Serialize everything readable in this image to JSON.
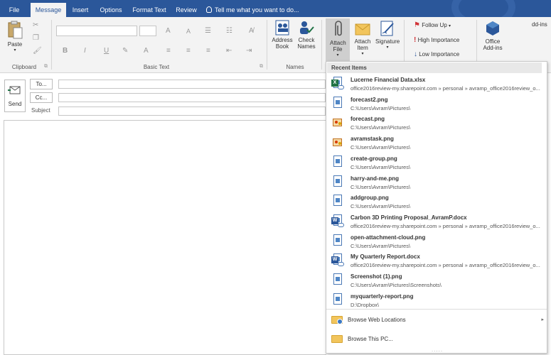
{
  "tabs": [
    {
      "label": "File",
      "active": false
    },
    {
      "label": "Message",
      "active": true
    },
    {
      "label": "Insert",
      "active": false
    },
    {
      "label": "Options",
      "active": false
    },
    {
      "label": "Format Text",
      "active": false
    },
    {
      "label": "Review",
      "active": false
    }
  ],
  "tell_me": "Tell me what you want to do...",
  "ribbon": {
    "clipboard": {
      "paste": "Paste",
      "label": "Clipboard"
    },
    "basic_text": {
      "label": "Basic Text"
    },
    "names": {
      "address_book": "Address Book",
      "check_names": "Check Names",
      "label": "Names"
    },
    "include": {
      "attach_file": "Attach File",
      "attach_item": "Attach Item",
      "signature": "Signature"
    },
    "tags": {
      "follow_up": "Follow Up",
      "high_importance": "High Importance",
      "low_importance": "Low Importance"
    },
    "addins": {
      "office_addins": "Office Add-ins"
    },
    "truncated": "dd-ins"
  },
  "compose": {
    "send": "Send",
    "to": "To...",
    "cc": "Cc...",
    "subject": "Subject"
  },
  "dropdown": {
    "header": "Recent Items",
    "items": [
      {
        "name": "Lucerne Financial Data.xlsx",
        "path": "office2016review-my.sharepoint.com » personal » avramp_office2016review_o...",
        "icon": "excel-cloud-icon"
      },
      {
        "name": "forecast2.png",
        "path": "C:\\Users\\Avram\\Pictures\\",
        "icon": "image-icon"
      },
      {
        "name": "forecast.png",
        "path": "C:\\Users\\Avram\\Pictures\\",
        "icon": "paint-icon"
      },
      {
        "name": "avramstask.png",
        "path": "C:\\Users\\Avram\\Pictures\\",
        "icon": "paint-icon"
      },
      {
        "name": "create-group.png",
        "path": "C:\\Users\\Avram\\Pictures\\",
        "icon": "image-icon"
      },
      {
        "name": "harry-and-me.png",
        "path": "C:\\Users\\Avram\\Pictures\\",
        "icon": "image-icon"
      },
      {
        "name": "addgroup.png",
        "path": "C:\\Users\\Avram\\Pictures\\",
        "icon": "image-icon"
      },
      {
        "name": "Carbon 3D Printing Proposal_AvramP.docx",
        "path": "office2016review-my.sharepoint.com » personal » avramp_office2016review_o...",
        "icon": "word-cloud-icon"
      },
      {
        "name": "open-attachment-cloud.png",
        "path": "C:\\Users\\Avram\\Pictures\\",
        "icon": "image-icon"
      },
      {
        "name": "My Quarterly Report.docx",
        "path": "office2016review-my.sharepoint.com » personal » avramp_office2016review_o...",
        "icon": "word-cloud-icon"
      },
      {
        "name": "Screenshot (1).png",
        "path": "C:\\Users\\Avram\\Pictures\\Screenshots\\",
        "icon": "image-icon"
      },
      {
        "name": "myquarterly-report.png",
        "path": "D:\\Dropbox\\",
        "icon": "image-icon"
      }
    ],
    "browse_web": "Browse Web Locations",
    "browse_pc": "Browse This PC...",
    "grip": "....."
  },
  "colors": {
    "accent": "#2b579a",
    "excel": "#217346",
    "word": "#2b579a",
    "flag": "#d13438"
  }
}
